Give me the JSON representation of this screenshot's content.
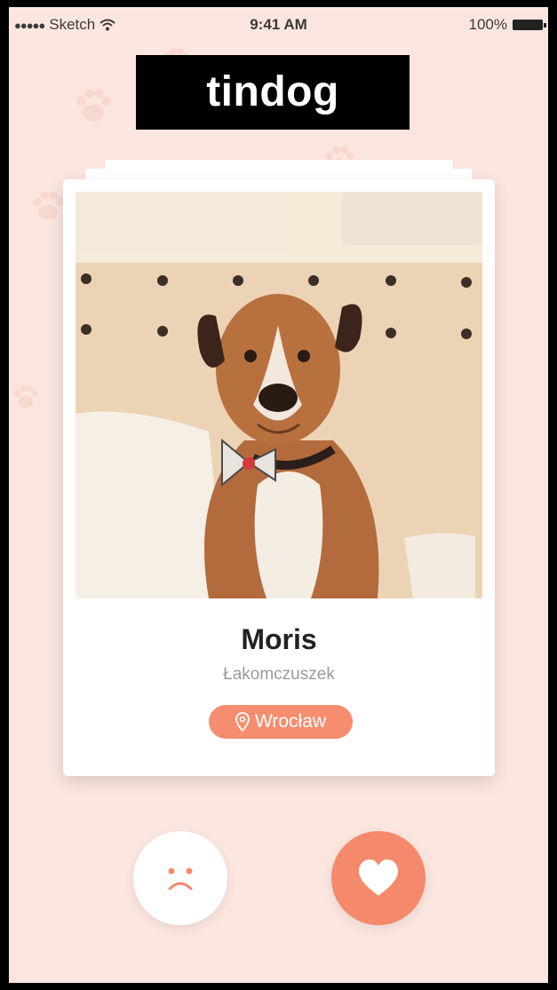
{
  "status_bar": {
    "carrier": "Sketch",
    "time": "9:41 AM",
    "battery": "100%"
  },
  "app": {
    "logo_text": "tindog"
  },
  "profile": {
    "name": "Moris",
    "nickname": "Łakomczuszek",
    "location": "Wrocław",
    "photo_icon": "dog-photo"
  },
  "actions": {
    "dislike_icon": "sad-face-icon",
    "like_icon": "heart-icon"
  },
  "colors": {
    "background": "#fbe6df",
    "accent": "#f48a6b"
  }
}
